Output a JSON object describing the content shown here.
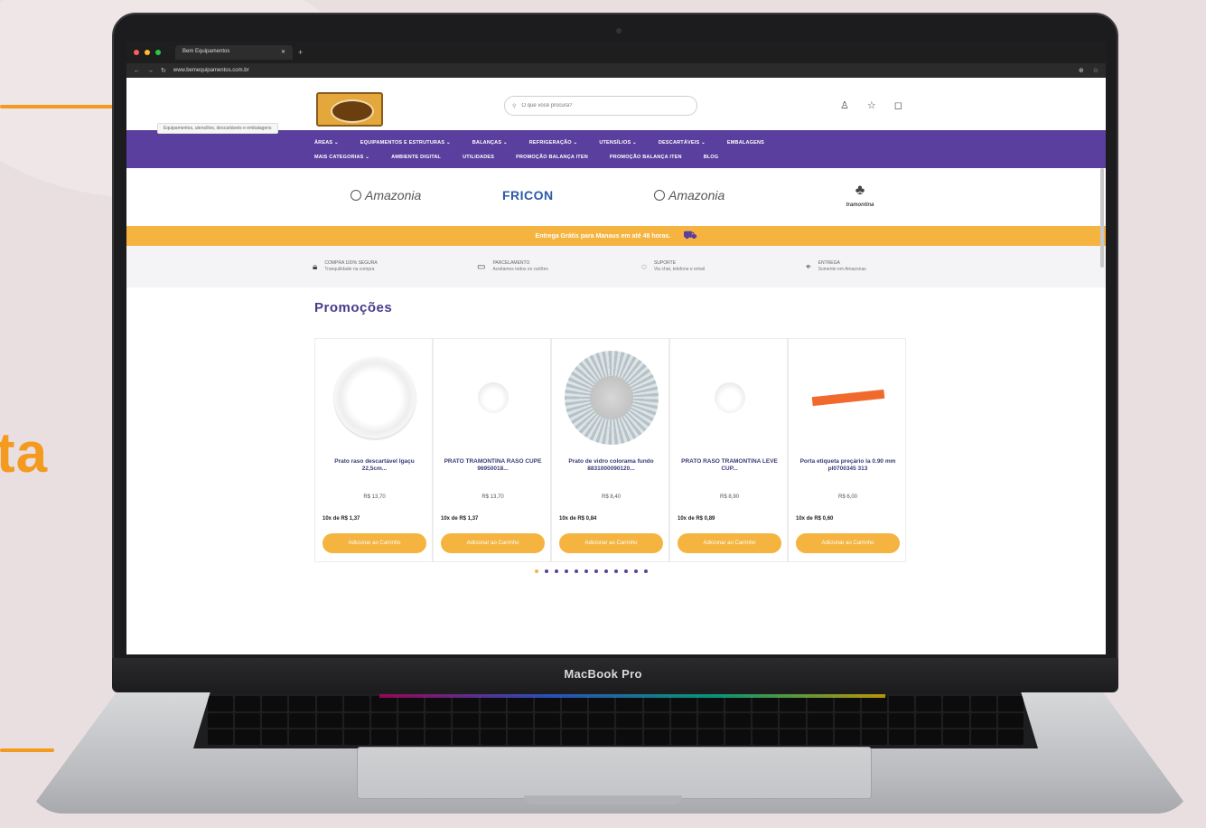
{
  "background": {
    "partial_word": "ta",
    "accent_color": "#f39a1f"
  },
  "laptop": {
    "model_label": "MacBook Pro"
  },
  "browser": {
    "tab_title": "Bem Equipamentos",
    "new_tab": "+",
    "url": "www.bemequipamentos.com.br",
    "tooltip": "Equipamentos, utensílios, descartáveis e embalagens"
  },
  "header": {
    "search_placeholder": "O que você procura?",
    "icons": [
      "user-icon",
      "star-icon",
      "cart-icon"
    ]
  },
  "nav": {
    "row1": [
      "ÁREAS ⌄",
      "EQUIPAMENTOS E ESTRUTURAS ⌄",
      "BALANÇAS ⌄",
      "REFRIGERAÇÃO ⌄",
      "UTENSÍLIOS ⌄",
      "DESCARTÁVEIS ⌄",
      "EMBALAGENS"
    ],
    "row2": [
      "MAIS CATEGORIAS ⌄",
      "AMBIENTE DIGITAL",
      "UTILIDADES",
      "PROMOÇÃO BALANÇA ITEN",
      "PROMOÇÃO BALANÇA ITEN",
      "BLOG"
    ],
    "color": "#5b3f9e"
  },
  "brands": [
    "Amazonia",
    "FRICON",
    "Amazonia",
    "tramontina"
  ],
  "delivery": {
    "text": "Entrega Grátis para Manaus em até 48 horas.",
    "color": "#f4b43f"
  },
  "features": [
    {
      "title": "COMPRA 100% SEGURA",
      "subtitle": "Tranquilidade na compra",
      "icon": "lock-icon"
    },
    {
      "title": "PARCELAMENTO",
      "subtitle": "Aceitamos todos os cartões",
      "icon": "card-icon"
    },
    {
      "title": "SUPORTE",
      "subtitle": "Via chat, telefone e email",
      "icon": "headset-icon"
    },
    {
      "title": "ENTREGA",
      "subtitle": "Somente em Amazonas",
      "icon": "pin-icon"
    }
  ],
  "promotions": {
    "title": "Promoções",
    "button_label": "Adicionar ao Carrinho",
    "products": [
      {
        "name": "Prato raso descartável Igaçu 22,5cm...",
        "price": "R$ 13,70",
        "installment": "10x de R$ 1,37",
        "image": "white-plate"
      },
      {
        "name": "PRATO TRAMONTINA RASO CUPE 96950018...",
        "price": "R$ 13,70",
        "installment": "10x de R$ 1,37",
        "image": "small-bowl"
      },
      {
        "name": "Prato de vidro colorama fundo 8831000090120...",
        "price": "R$ 8,40",
        "installment": "10x de R$ 0,84",
        "image": "glass-plate"
      },
      {
        "name": "PRATO RASO TRAMONTINA LEVE CUP...",
        "price": "R$ 8,90",
        "installment": "10x de R$ 0,89",
        "image": "small-bowl"
      },
      {
        "name": "Porta etiqueta preçário la 0.90 mm pl0700345 313",
        "price": "R$ 6,00",
        "installment": "10x de R$ 0,60",
        "image": "orange-strip"
      }
    ],
    "pages": 12,
    "active_page": 1
  }
}
